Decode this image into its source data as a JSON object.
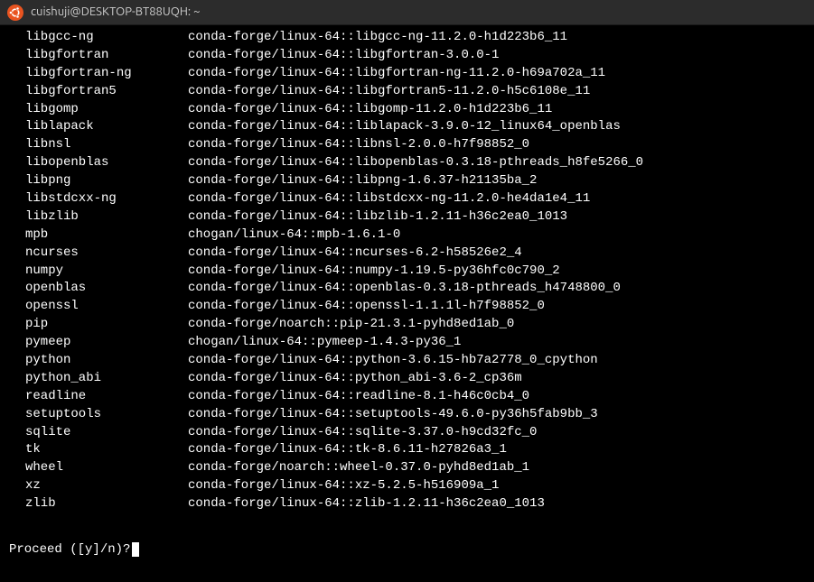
{
  "window": {
    "title": "cuishuji@DESKTOP-BT88UQH: ~"
  },
  "packages": [
    {
      "name": "libgcc-ng",
      "spec": "conda-forge/linux-64::libgcc-ng-11.2.0-h1d223b6_11"
    },
    {
      "name": "libgfortran",
      "spec": "conda-forge/linux-64::libgfortran-3.0.0-1"
    },
    {
      "name": "libgfortran-ng",
      "spec": "conda-forge/linux-64::libgfortran-ng-11.2.0-h69a702a_11"
    },
    {
      "name": "libgfortran5",
      "spec": "conda-forge/linux-64::libgfortran5-11.2.0-h5c6108e_11"
    },
    {
      "name": "libgomp",
      "spec": "conda-forge/linux-64::libgomp-11.2.0-h1d223b6_11"
    },
    {
      "name": "liblapack",
      "spec": "conda-forge/linux-64::liblapack-3.9.0-12_linux64_openblas"
    },
    {
      "name": "libnsl",
      "spec": "conda-forge/linux-64::libnsl-2.0.0-h7f98852_0"
    },
    {
      "name": "libopenblas",
      "spec": "conda-forge/linux-64::libopenblas-0.3.18-pthreads_h8fe5266_0"
    },
    {
      "name": "libpng",
      "spec": "conda-forge/linux-64::libpng-1.6.37-h21135ba_2"
    },
    {
      "name": "libstdcxx-ng",
      "spec": "conda-forge/linux-64::libstdcxx-ng-11.2.0-he4da1e4_11"
    },
    {
      "name": "libzlib",
      "spec": "conda-forge/linux-64::libzlib-1.2.11-h36c2ea0_1013"
    },
    {
      "name": "mpb",
      "spec": "chogan/linux-64::mpb-1.6.1-0"
    },
    {
      "name": "ncurses",
      "spec": "conda-forge/linux-64::ncurses-6.2-h58526e2_4"
    },
    {
      "name": "numpy",
      "spec": "conda-forge/linux-64::numpy-1.19.5-py36hfc0c790_2"
    },
    {
      "name": "openblas",
      "spec": "conda-forge/linux-64::openblas-0.3.18-pthreads_h4748800_0"
    },
    {
      "name": "openssl",
      "spec": "conda-forge/linux-64::openssl-1.1.1l-h7f98852_0"
    },
    {
      "name": "pip",
      "spec": "conda-forge/noarch::pip-21.3.1-pyhd8ed1ab_0"
    },
    {
      "name": "pymeep",
      "spec": "chogan/linux-64::pymeep-1.4.3-py36_1"
    },
    {
      "name": "python",
      "spec": "conda-forge/linux-64::python-3.6.15-hb7a2778_0_cpython"
    },
    {
      "name": "python_abi",
      "spec": "conda-forge/linux-64::python_abi-3.6-2_cp36m"
    },
    {
      "name": "readline",
      "spec": "conda-forge/linux-64::readline-8.1-h46c0cb4_0"
    },
    {
      "name": "setuptools",
      "spec": "conda-forge/linux-64::setuptools-49.6.0-py36h5fab9bb_3"
    },
    {
      "name": "sqlite",
      "spec": "conda-forge/linux-64::sqlite-3.37.0-h9cd32fc_0"
    },
    {
      "name": "tk",
      "spec": "conda-forge/linux-64::tk-8.6.11-h27826a3_1"
    },
    {
      "name": "wheel",
      "spec": "conda-forge/noarch::wheel-0.37.0-pyhd8ed1ab_1"
    },
    {
      "name": "xz",
      "spec": "conda-forge/linux-64::xz-5.2.5-h516909a_1"
    },
    {
      "name": "zlib",
      "spec": "conda-forge/linux-64::zlib-1.2.11-h36c2ea0_1013"
    }
  ],
  "prompt": {
    "text": "Proceed ([y]/n)? "
  }
}
